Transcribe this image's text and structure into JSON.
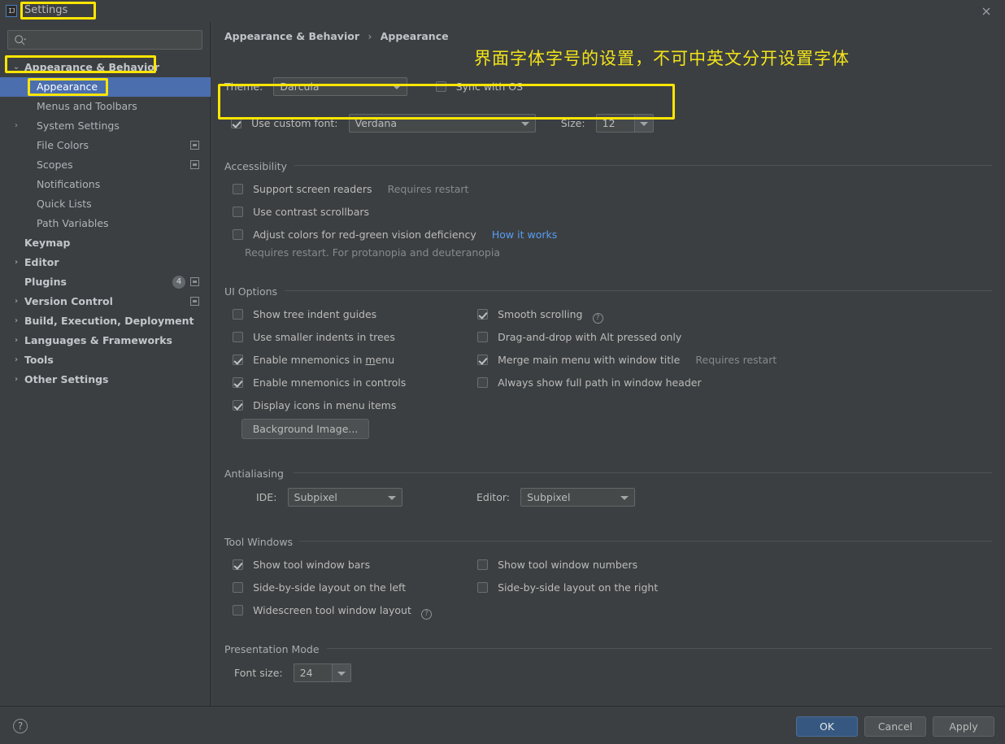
{
  "window": {
    "title": "Settings",
    "app_icon": "intellij-idea-icon",
    "close_icon": "close-icon"
  },
  "sidebar": {
    "search": {
      "placeholder": "",
      "value": "",
      "icon": "search-icon"
    },
    "items": [
      {
        "label": "Appearance & Behavior",
        "level": 0,
        "arrow": "⌄",
        "bold": true,
        "selected": false
      },
      {
        "label": "Appearance",
        "level": 1,
        "arrow": "",
        "bold": false,
        "selected": true
      },
      {
        "label": "Menus and Toolbars",
        "level": 1,
        "arrow": "",
        "bold": false,
        "selected": false
      },
      {
        "label": "System Settings",
        "level": 1,
        "arrow": "›",
        "bold": false,
        "selected": false
      },
      {
        "label": "File Colors",
        "level": 1,
        "arrow": "",
        "bold": false,
        "selected": false,
        "right_icon": "project-level-icon"
      },
      {
        "label": "Scopes",
        "level": 1,
        "arrow": "",
        "bold": false,
        "selected": false,
        "right_icon": "project-level-icon"
      },
      {
        "label": "Notifications",
        "level": 1,
        "arrow": "",
        "bold": false,
        "selected": false
      },
      {
        "label": "Quick Lists",
        "level": 1,
        "arrow": "",
        "bold": false,
        "selected": false
      },
      {
        "label": "Path Variables",
        "level": 1,
        "arrow": "",
        "bold": false,
        "selected": false
      },
      {
        "label": "Keymap",
        "level": 0,
        "arrow": "",
        "bold": true,
        "selected": false
      },
      {
        "label": "Editor",
        "level": 0,
        "arrow": "›",
        "bold": true,
        "selected": false
      },
      {
        "label": "Plugins",
        "level": 0,
        "arrow": "",
        "bold": true,
        "selected": false,
        "badge": "4",
        "right_icon": "project-level-icon"
      },
      {
        "label": "Version Control",
        "level": 0,
        "arrow": "›",
        "bold": true,
        "selected": false,
        "right_icon": "project-level-icon"
      },
      {
        "label": "Build, Execution, Deployment",
        "level": 0,
        "arrow": "›",
        "bold": true,
        "selected": false
      },
      {
        "label": "Languages & Frameworks",
        "level": 0,
        "arrow": "›",
        "bold": true,
        "selected": false
      },
      {
        "label": "Tools",
        "level": 0,
        "arrow": "›",
        "bold": true,
        "selected": false
      },
      {
        "label": "Other Settings",
        "level": 0,
        "arrow": "›",
        "bold": true,
        "selected": false
      }
    ]
  },
  "main": {
    "breadcrumb": {
      "root": "Appearance & Behavior",
      "separator": "›",
      "leaf": "Appearance"
    },
    "annotation": "界面字体字号的设置，不可中英文分开设置字体",
    "theme": {
      "label": "Theme:",
      "value": "Darcula",
      "sync_label": "Sync with OS",
      "sync_checked": false
    },
    "custom_font": {
      "checkbox_label": "Use custom font:",
      "checked": true,
      "font_value": "Verdana",
      "size_label": "Size:",
      "size_value": "12"
    },
    "accessibility": {
      "title": "Accessibility",
      "items": [
        {
          "label": "Support screen readers",
          "checked": false,
          "hint": "Requires restart"
        },
        {
          "label": "Use contrast scrollbars",
          "checked": false,
          "hint": ""
        },
        {
          "label": "Adjust colors for red-green vision deficiency",
          "checked": false,
          "link": "How it works"
        }
      ],
      "sub_hint": "Requires restart. For protanopia and deuteranopia"
    },
    "ui_options": {
      "title": "UI Options",
      "left": [
        {
          "label": "Show tree indent guides",
          "checked": false
        },
        {
          "label": "Use smaller indents in trees",
          "checked": false
        },
        {
          "label": "Enable mnemonics in menu",
          "checked": true,
          "mnemonic": "m"
        },
        {
          "label": "Enable mnemonics in controls",
          "checked": true
        },
        {
          "label": "Display icons in menu items",
          "checked": true
        }
      ],
      "right": [
        {
          "label": "Smooth scrolling",
          "checked": true,
          "help": true
        },
        {
          "label": "Drag-and-drop with Alt pressed only",
          "checked": false
        },
        {
          "label": "Merge main menu with window title",
          "checked": true,
          "hint": "Requires restart"
        },
        {
          "label": "Always show full path in window header",
          "checked": false
        }
      ],
      "background_image_button": "Background Image..."
    },
    "antialiasing": {
      "title": "Antialiasing",
      "ide_label": "IDE:",
      "ide_value": "Subpixel",
      "editor_label": "Editor:",
      "editor_value": "Subpixel"
    },
    "tool_windows": {
      "title": "Tool Windows",
      "left": [
        {
          "label": "Show tool window bars",
          "checked": true
        },
        {
          "label": "Side-by-side layout on the left",
          "checked": false
        },
        {
          "label": "Widescreen tool window layout",
          "checked": false,
          "help": true
        }
      ],
      "right": [
        {
          "label": "Show tool window numbers",
          "checked": false
        },
        {
          "label": "Side-by-side layout on the right",
          "checked": false
        }
      ]
    },
    "presentation_mode": {
      "title": "Presentation Mode",
      "font_size_label": "Font size:",
      "font_size_value": "24"
    }
  },
  "footer": {
    "help_icon": "?",
    "ok": "OK",
    "cancel": "Cancel",
    "apply": "Apply"
  },
  "colors": {
    "accent_blue": "#4b6eaf",
    "ok_button": "#365880",
    "link": "#589df6",
    "annotation_yellow": "#ffe500",
    "background": "#3c3f41"
  }
}
